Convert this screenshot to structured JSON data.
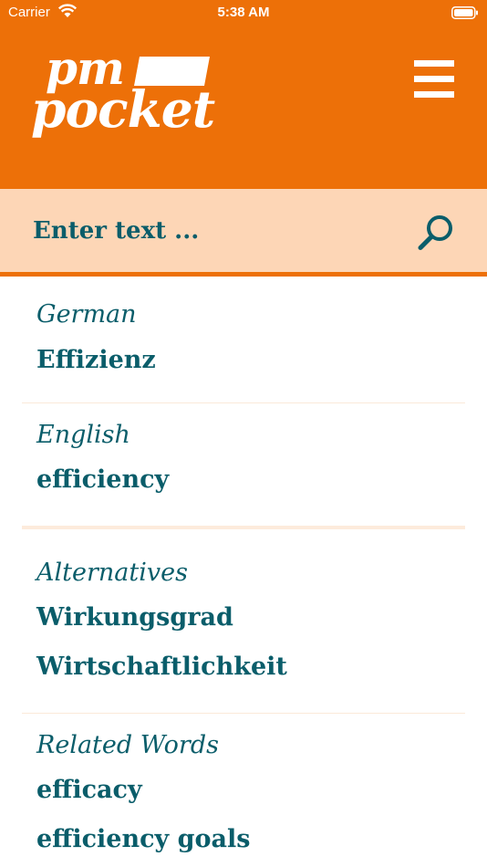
{
  "status_bar": {
    "carrier": "Carrier",
    "time": "5:38 AM"
  },
  "header": {
    "logo_line1": "pm",
    "logo_line2": "pocket",
    "accent_color": "#ed7008",
    "menu_icon": "hamburger-menu-icon"
  },
  "search": {
    "placeholder": "Enter text ...",
    "value": "",
    "icon": "search-icon"
  },
  "sections": {
    "german": {
      "label": "German",
      "term": "Effizienz"
    },
    "english": {
      "label": "English",
      "term": "efficiency"
    },
    "alternatives": {
      "label": "Alternatives",
      "items": [
        "Wirkungsgrad",
        "Wirtschaftlichkeit"
      ]
    },
    "related": {
      "label": "Related Words",
      "items": [
        "efficacy",
        "efficiency goals"
      ]
    }
  },
  "colors": {
    "text": "#0a5d6a",
    "search_bg": "#fdd6b6",
    "white": "#ffffff"
  }
}
